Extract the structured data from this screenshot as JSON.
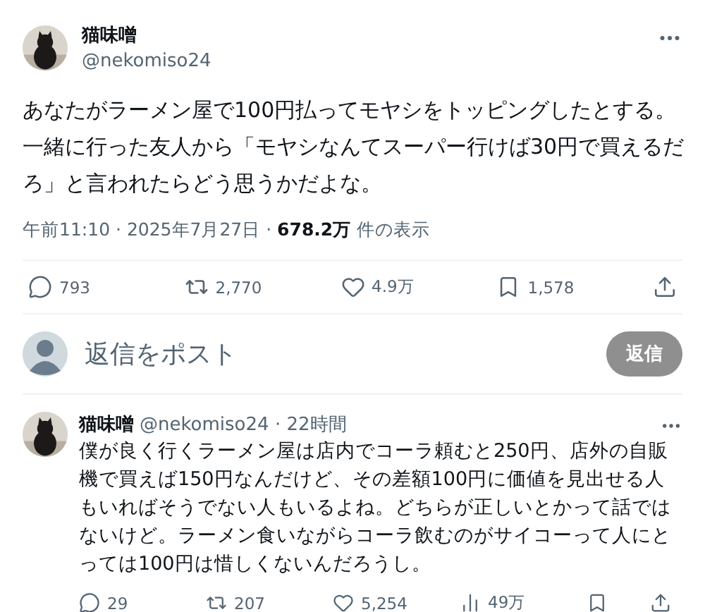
{
  "post": {
    "name": "猫味噌",
    "handle": "@nekomiso24",
    "text": "あなたがラーメン屋で100円払ってモヤシをトッピングしたとする。一緒に行った友人から「モヤシなんてスーパー行けば30円で買えるだろ」と言われたらどう思うかだよな。",
    "time": "午前11:10 · 2025年7月27日 · ",
    "views": "678.2万",
    "views_label": " 件の表示",
    "actions": [
      {
        "kind": "reply",
        "count": "793"
      },
      {
        "kind": "repost",
        "count": "2,770"
      },
      {
        "kind": "like",
        "count": "4.9万"
      },
      {
        "kind": "bookmark",
        "count": "1,578"
      },
      {
        "kind": "share"
      }
    ]
  },
  "composer": {
    "placeholder": "返信をポスト",
    "button": "返信"
  },
  "reply": {
    "name": "猫味噌",
    "handle": "@nekomiso24",
    "age": " · 22時間",
    "text": "僕が良く行くラーメン屋は店内でコーラ頼むと250円、店外の自販機で買えば150円なんだけど、その差額100円に価値を見出せる人もいればそうでない人もいるよね。どちらが正しいとかって話ではないけど。ラーメン食いながらコーラ飲むのがサイコーって人にとっては100円は惜しくないんだろうし。",
    "actions": [
      {
        "kind": "reply",
        "count": "29"
      },
      {
        "kind": "repost",
        "count": "207"
      },
      {
        "kind": "like",
        "count": "5,254"
      },
      {
        "kind": "views",
        "count": "49万"
      },
      {
        "kind": "bookmark"
      },
      {
        "kind": "share"
      }
    ]
  }
}
